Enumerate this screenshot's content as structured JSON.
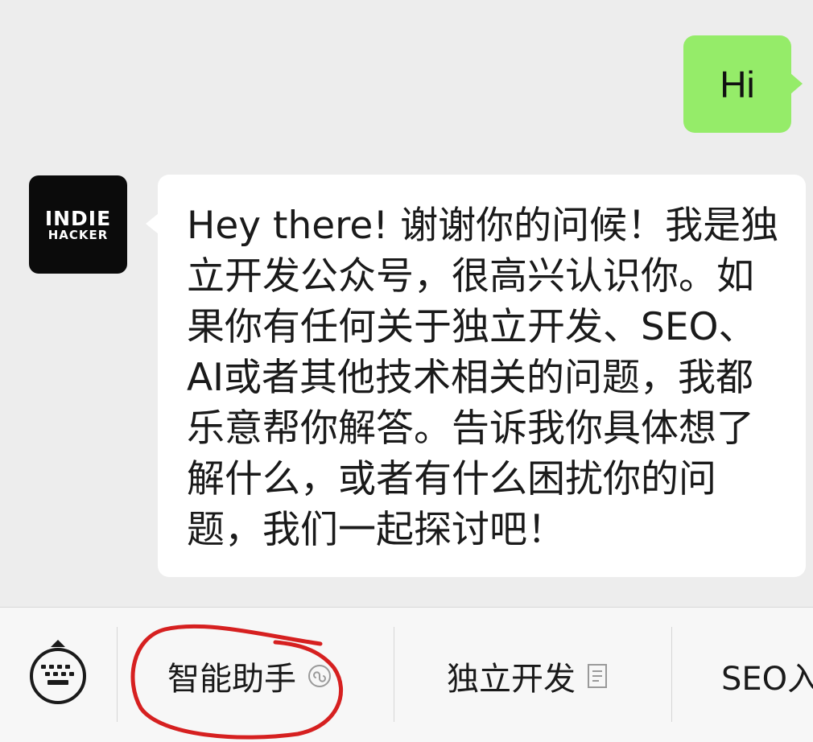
{
  "conversation": {
    "outgoing": {
      "text": "Hi",
      "bubble_color": "#95ec69"
    },
    "incoming": {
      "avatar": {
        "line1": "INDIE",
        "line2": "HACKER"
      },
      "text": "Hey there! 谢谢你的问候！我是独立开发公众号，很高兴认识你。如果你有任何关于独立开发、SEO、AI或者其他技术相关的问题，我都乐意帮你解答。告诉我你具体想了解什么，或者有什么困扰你的问题，我们一起探讨吧！"
    }
  },
  "menu_bar": {
    "keyboard_icon": "keyboard-icon",
    "items": [
      {
        "label": "智能助手",
        "icon": "mini-program-icon"
      },
      {
        "label": "独立开发",
        "icon": "document-icon"
      },
      {
        "label": "SEO入"
      }
    ]
  },
  "annotation": {
    "shape": "hand-drawn-circle",
    "color": "#d62020"
  }
}
